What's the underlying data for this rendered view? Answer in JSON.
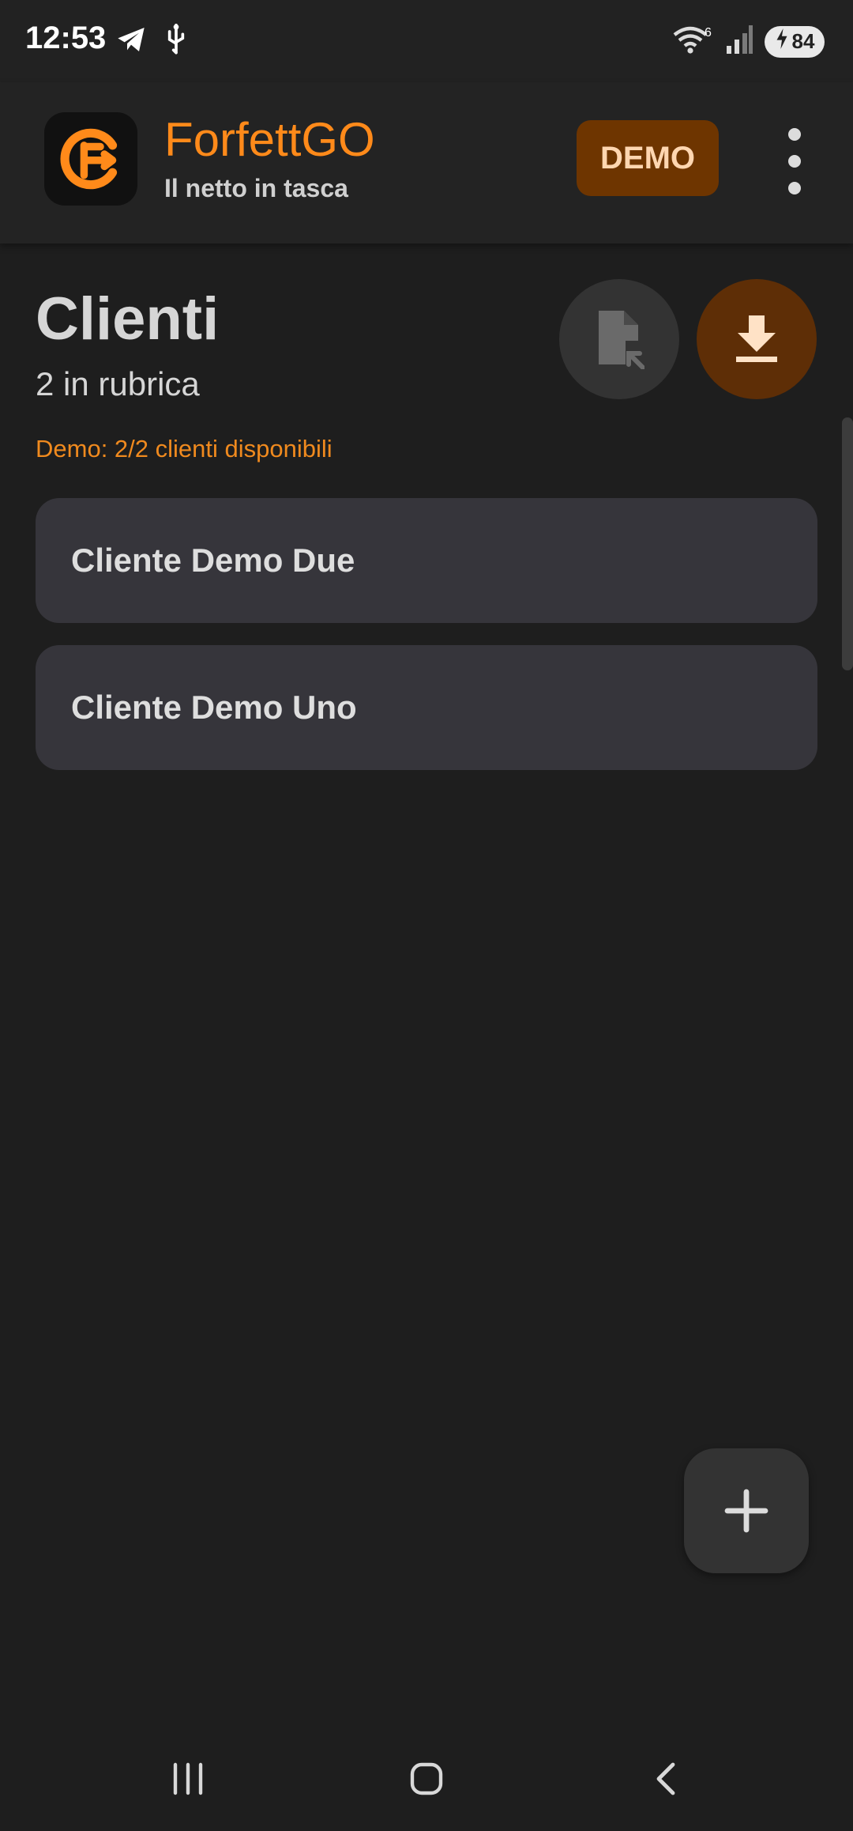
{
  "status_bar": {
    "time": "12:53",
    "battery": "84",
    "wifi_badge": "6",
    "icons": [
      "telegram-icon",
      "usb-icon",
      "wifi-icon",
      "signal-icon",
      "battery-charging-icon"
    ]
  },
  "app_bar": {
    "title": "ForfettGO",
    "subtitle": "Il netto in tasca",
    "demo_badge": "DEMO"
  },
  "page": {
    "title": "Clienti",
    "count": "2 in rubrica",
    "demo_note": "Demo: 2/2 clienti disponibili"
  },
  "clients": [
    {
      "name": "Cliente Demo Due"
    },
    {
      "name": "Cliente Demo Uno"
    }
  ],
  "colors": {
    "accent": "#ff8a1a",
    "background": "#1e1e1e",
    "card": "#36353b",
    "demo_badge_bg": "#6e3500"
  }
}
